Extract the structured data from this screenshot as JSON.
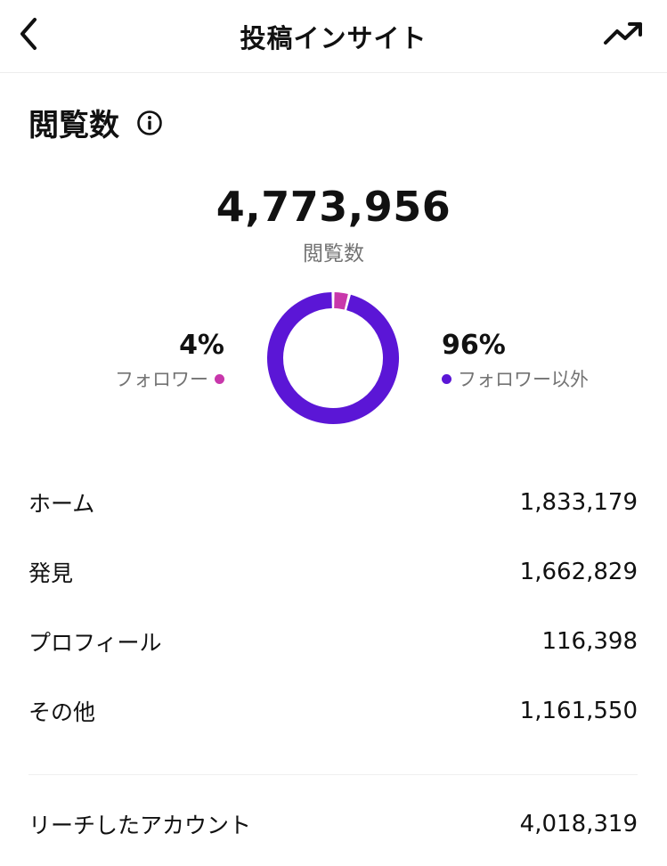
{
  "header": {
    "title": "投稿インサイト",
    "back_icon": "chevron-left-icon",
    "trend_icon": "trending-up-icon"
  },
  "views": {
    "section_title": "閲覧数",
    "info_icon": "info-icon",
    "total": "4,773,956",
    "total_label": "閲覧数"
  },
  "breakdown": {
    "followers": {
      "percent": "4%",
      "label": "フォロワー",
      "color": "#c837ab"
    },
    "non_followers": {
      "percent": "96%",
      "label": "フォロワー以外",
      "color": "#5b16d6"
    }
  },
  "chart_data": {
    "type": "pie",
    "categories": [
      "フォロワー",
      "フォロワー以外"
    ],
    "values": [
      4,
      96
    ]
  },
  "sources": [
    {
      "label": "ホーム",
      "value": "1,833,179"
    },
    {
      "label": "発見",
      "value": "1,662,829"
    },
    {
      "label": "プロフィール",
      "value": "116,398"
    },
    {
      "label": "その他",
      "value": "1,161,550"
    }
  ],
  "reach": {
    "label": "リーチしたアカウント",
    "value": "4,018,319"
  },
  "colors": {
    "follower": "#c837ab",
    "non_follower": "#5b16d6",
    "text_secondary": "#737373"
  }
}
